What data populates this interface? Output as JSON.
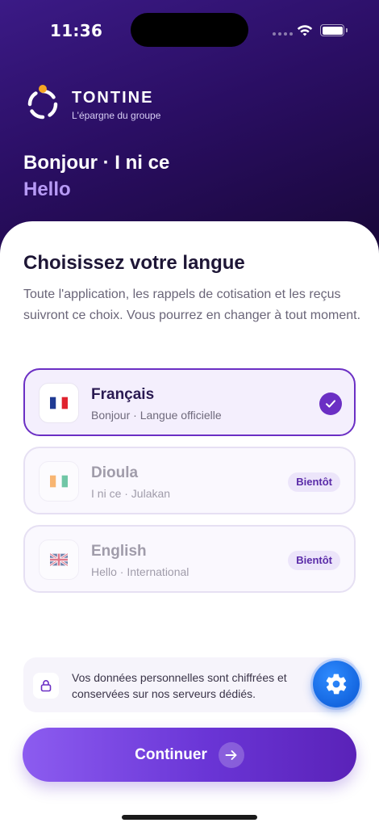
{
  "status_bar": {
    "time": "11:36"
  },
  "brand": {
    "name": "TONTINE",
    "tagline": "L'épargne du groupe"
  },
  "greeting": {
    "line1": "Bonjour · I ni ce",
    "line2": "Hello"
  },
  "language_picker": {
    "title": "Choisissez votre langue",
    "description": "Toute l'application, les rappels de cotisation et les reçus suivront ce choix. Vous pourrez en changer à tout moment.",
    "options": [
      {
        "name": "Français",
        "subtitle": "Bonjour · Langue officielle",
        "flag": "🇫🇷",
        "state": "selected"
      },
      {
        "name": "Dioula",
        "subtitle": "I ni ce · Julakan",
        "flag": "🇨🇮",
        "state": "soon",
        "badge": "Bientôt"
      },
      {
        "name": "English",
        "subtitle": "Hello · International",
        "flag": "🇬🇧",
        "state": "soon",
        "badge": "Bientôt"
      }
    ]
  },
  "privacy": {
    "text": "Vos données personnelles sont chiffrées et conservées sur nos serveurs dédiés."
  },
  "actions": {
    "continue_label": "Continuer"
  },
  "colors": {
    "accent": "#6b2fc4",
    "hero": "#2a0e63",
    "fab": "#1466e0"
  },
  "icons": [
    "logo-ring-icon",
    "wifi-icon",
    "battery-icon",
    "check-icon",
    "lock-icon",
    "gear-icon",
    "arrow-right-icon"
  ]
}
